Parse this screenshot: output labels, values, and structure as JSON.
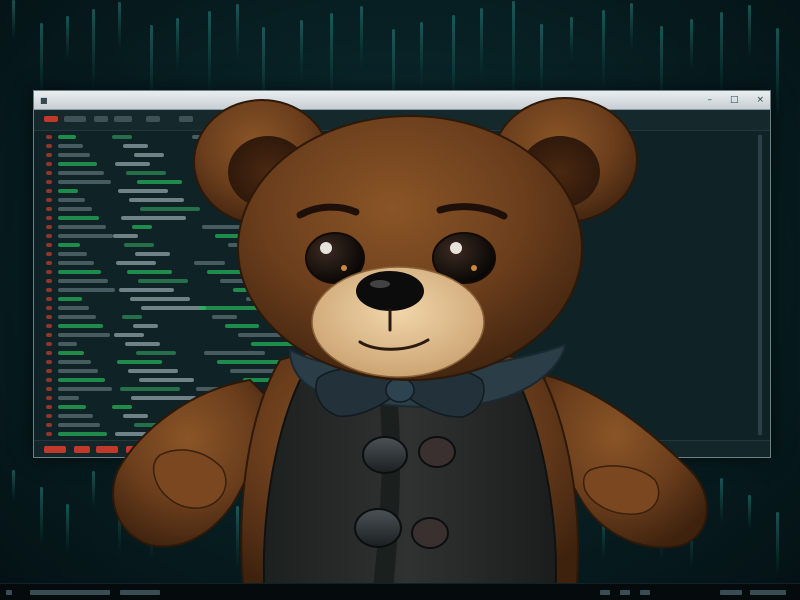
{
  "scene": {
    "subject": "teddy-bear",
    "palette": {
      "background": "#06161a",
      "fur": "#6b3e1c",
      "fur_dark": "#3e220e",
      "muzzle": "#e8c79a",
      "vest": "#2a2c2a",
      "bowtie": "#2b3d47",
      "code_green": "#27b05a",
      "code_red": "#c0392b"
    }
  },
  "window": {
    "title": "",
    "controls": [
      "minimize-icon",
      "maximize-icon",
      "close-icon"
    ]
  }
}
